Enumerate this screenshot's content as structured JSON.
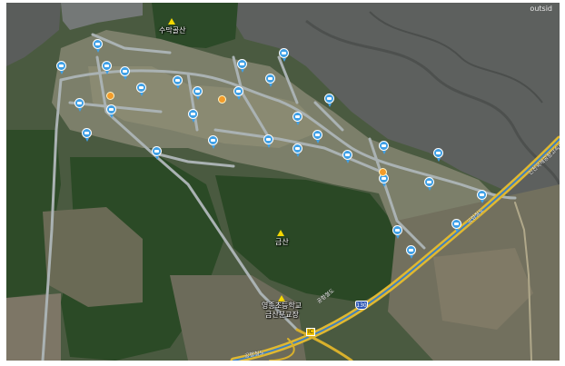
{
  "corner_text": "outsid",
  "colors": {
    "water": "#5c5f5d",
    "forest": "#2f4f2a",
    "road": "#aab2b3",
    "highway": "#e0b830",
    "cctv_marker": "#3fa0e6",
    "spot_marker": "#f39c2a"
  },
  "places": {
    "sumagolsan": "수막골산",
    "geumsan": "금산",
    "school_line1": "영종초등학교",
    "school_line2": "금산분교장"
  },
  "highway": {
    "ic_badge": "IC",
    "shield_number": "130",
    "labels": [
      "인천국제공항고속도로",
      "공항철도",
      "공항철도",
      "공항철도"
    ]
  },
  "markers": {
    "cctv_icon": "cctv-camera-icon",
    "spot_icon": "orange-circle-icon"
  }
}
